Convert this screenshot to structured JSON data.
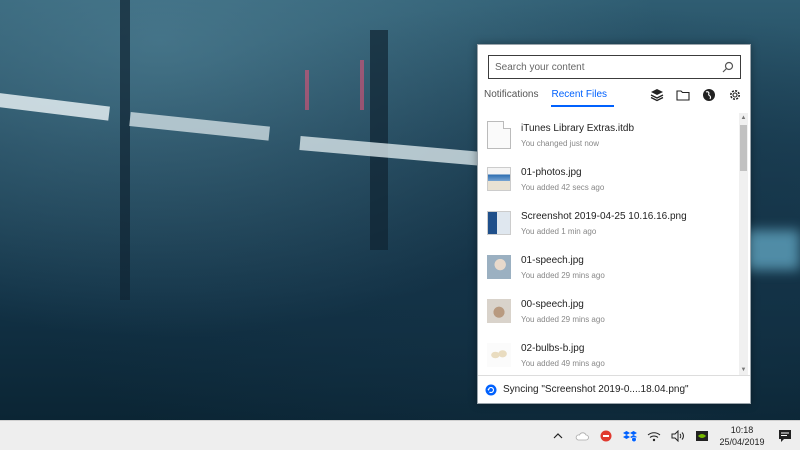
{
  "panel": {
    "search": {
      "placeholder": "Search your content"
    },
    "tabs": [
      {
        "label": "Notifications",
        "active": false
      },
      {
        "label": "Recent Files",
        "active": true
      }
    ],
    "tab_icons": [
      "layers-icon",
      "folder-icon",
      "globe-icon",
      "gear-icon"
    ],
    "files": [
      {
        "name": "iTunes Library Extras.itdb",
        "status": "You changed just now",
        "thumb": "doc"
      },
      {
        "name": "01-photos.jpg",
        "status": "You added 42 secs ago",
        "thumb": "img1"
      },
      {
        "name": "Screenshot 2019-04-25 10.16.16.png",
        "status": "You added 1 min ago",
        "thumb": "img2"
      },
      {
        "name": "01-speech.jpg",
        "status": "You added 29 mins ago",
        "thumb": "img3"
      },
      {
        "name": "00-speech.jpg",
        "status": "You added 29 mins ago",
        "thumb": "img4"
      },
      {
        "name": "02-bulbs-b.jpg",
        "status": "You added 49 mins ago",
        "thumb": "img5"
      }
    ],
    "footer": {
      "sync_text": "Syncing \"Screenshot 2019-0....18.04.png\""
    },
    "accent_color": "#0061fe"
  },
  "taskbar": {
    "tray_icons": [
      "chevron-up-icon",
      "cloud-icon",
      "badge-icon",
      "dropbox-icon",
      "wifi-icon",
      "volume-icon",
      "nvidia-icon"
    ],
    "time": "10:18",
    "date": "25/04/2019"
  }
}
